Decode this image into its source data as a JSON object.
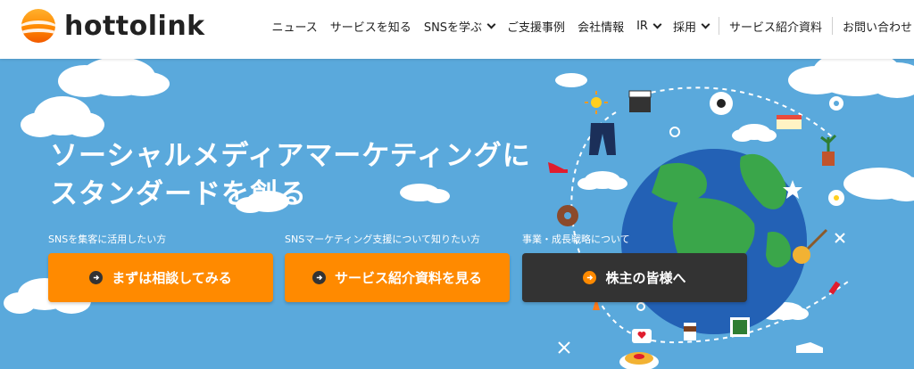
{
  "brand": {
    "name": "hottolink"
  },
  "nav": {
    "items": [
      {
        "label": "ニュース",
        "dropdown": false
      },
      {
        "label": "サービスを知る",
        "dropdown": false
      },
      {
        "label": "SNSを学ぶ",
        "dropdown": true
      },
      {
        "label": "ご支援事例",
        "dropdown": false
      },
      {
        "label": "会社情報",
        "dropdown": false
      },
      {
        "label": "IR",
        "dropdown": true
      },
      {
        "label": "採用",
        "dropdown": true
      }
    ],
    "doc_link": "サービス紹介資料",
    "contact_link": "お問い合わせ"
  },
  "hero": {
    "headline_line1": "ソーシャルメディアマーケティングに",
    "headline_line2": "スタンダードを創る"
  },
  "cta": [
    {
      "label": "SNSを集客に活用したい方",
      "button": "まずは相談してみる",
      "style": "orange"
    },
    {
      "label": "SNSマーケティング支援について知りたい方",
      "button": "サービス紹介資料を見る",
      "style": "orange"
    },
    {
      "label": "事業・成長戦略について",
      "button": "株主の皆様へ",
      "style": "dark"
    }
  ],
  "colors": {
    "accent": "#ff8a00",
    "sky": "#5aa9dc",
    "dark_button": "#333333"
  }
}
